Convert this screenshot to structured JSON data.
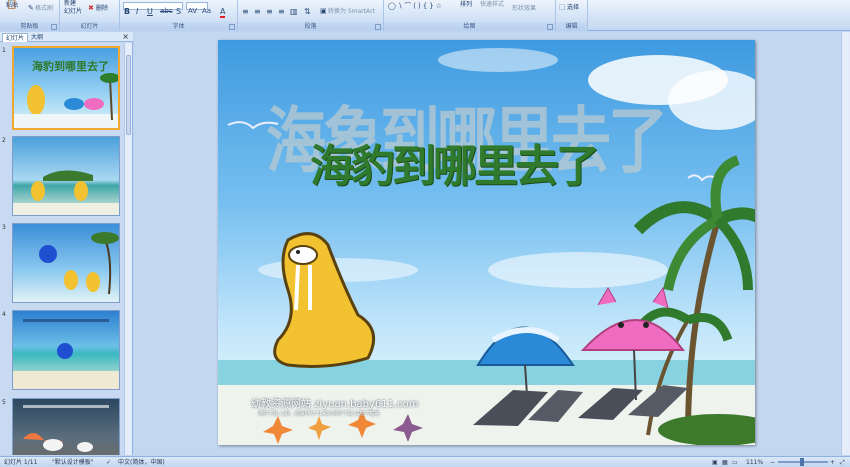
{
  "ribbon": {
    "clipboard": {
      "paste": "粘贴",
      "format_painter": "格式刷",
      "label": "剪贴板"
    },
    "slides": {
      "new_slide": "新建\n幻灯片",
      "delete": "删除",
      "label": "幻灯片"
    },
    "font": {
      "label": "字体"
    },
    "paragraph": {
      "convert_smartart": "转换为 SmartArt",
      "label": "段落"
    },
    "drawing": {
      "arrange": "排列",
      "quick_styles": "快速样式",
      "shape_effects": "形状效果",
      "label": "绘图"
    },
    "editing": {
      "select": "选择",
      "label": "编辑"
    }
  },
  "left_pane": {
    "tabs": [
      "幻灯片",
      "大纲"
    ],
    "close": "×",
    "slide_numbers": [
      "1",
      "2",
      "3",
      "4",
      "5"
    ]
  },
  "slide": {
    "title_shadow": "海象到哪里去了",
    "title": "海豹到哪里去了",
    "website": "幼教资源网站  ziyuan.baby611.com",
    "website_sub": "课件下载  儿歌、故事MP3  FLASH课件下载  试卷下载等"
  },
  "status": {
    "slide_info": "幻灯片 1/11",
    "theme": "\"默认设计模板\"",
    "language": "中文(简体，中国)",
    "zoom": "111%"
  },
  "colors": {
    "ribbon_bg": "#d3e3f6",
    "title_green": "#2f7a2c",
    "selected_thumb": "#f0a830"
  }
}
